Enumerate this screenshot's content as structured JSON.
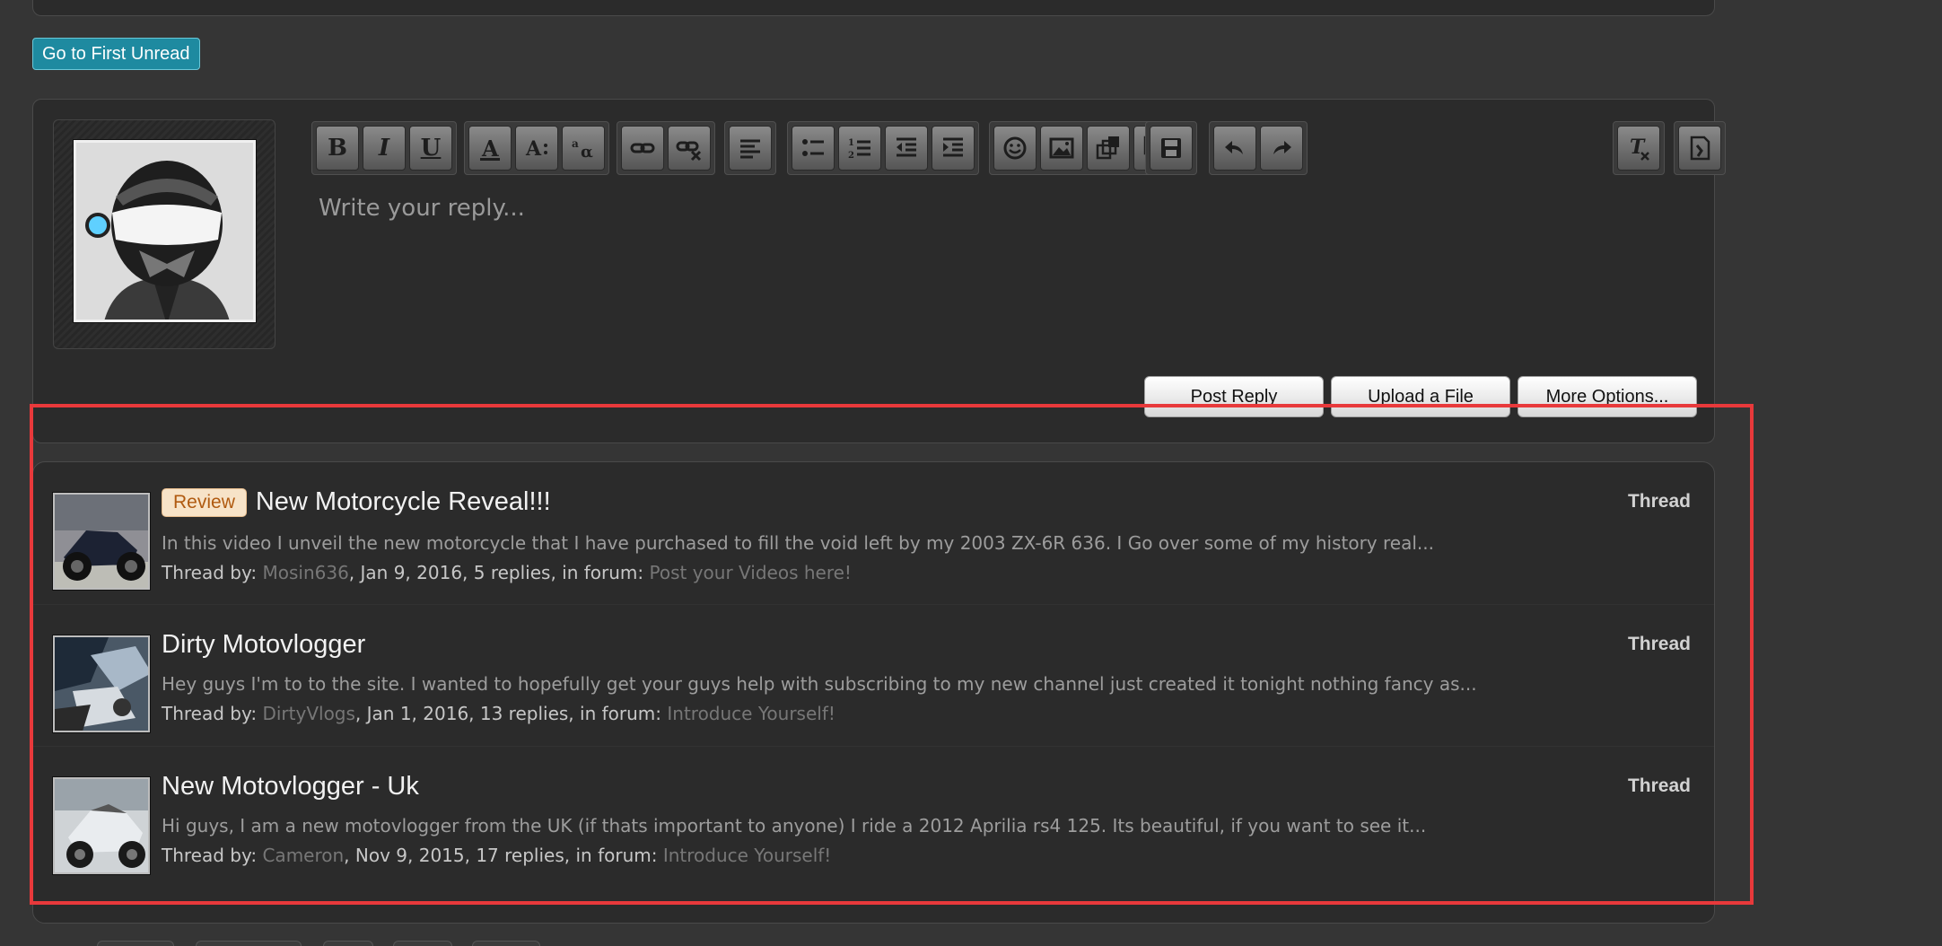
{
  "first_unread_label": "Go to First Unread",
  "reply": {
    "placeholder": "Write your reply...",
    "post_reply": "Post Reply",
    "upload_file": "Upload a File",
    "more_options": "More Options..."
  },
  "toolbar": {
    "bold": "B",
    "italic": "I",
    "underline": "U"
  },
  "threads": [
    {
      "prefix": "Review",
      "title": "New Motorcycle Reveal!!!",
      "snippet": "In this video I unveil the new motorcycle that I have purchased to fill the void left by my 2003 ZX-6R 636. I Go over some of my history real...",
      "meta_prefix": "Thread by: ",
      "author": "Mosin636",
      "meta_middle": ", Jan 9, 2016, 5 replies, in forum: ",
      "forum": "Post your Videos here!",
      "type": "Thread"
    },
    {
      "prefix": "",
      "title": "Dirty Motovlogger",
      "snippet": "Hey guys I'm to to the site. I wanted to hopefully get your guys help with subscribing to my new channel just created it tonight nothing fancy as...",
      "meta_prefix": "Thread by: ",
      "author": "DirtyVlogs",
      "meta_middle": ", Jan 1, 2016, 13 replies, in forum: ",
      "forum": "Introduce Yourself!",
      "type": "Thread"
    },
    {
      "prefix": "",
      "title": "New Motovlogger - Uk",
      "snippet": "Hi guys, I am a new motovlogger from the UK (if thats important to anyone) I ride a 2012 Aprilia rs4 125. Its beautiful, if you want to see it...",
      "meta_prefix": "Thread by: ",
      "author": "Cameron",
      "meta_middle": ", Nov 9, 2015, 17 replies, in forum: ",
      "forum": "Introduce Yourself!",
      "type": "Thread"
    }
  ],
  "colors": {
    "accent": "#1e8aa0",
    "highlight": "#e8393b",
    "prefix_bg": "#f7e3c8"
  }
}
